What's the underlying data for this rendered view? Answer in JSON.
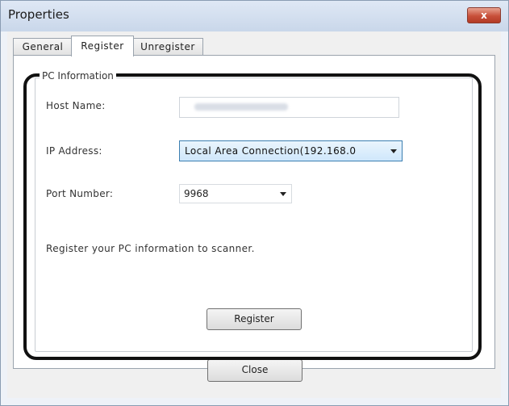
{
  "window": {
    "title": "Properties",
    "close_glyph": "x"
  },
  "tabs": [
    {
      "label": "General",
      "active": false
    },
    {
      "label": "Register",
      "active": true
    },
    {
      "label": "Unregister",
      "active": false
    }
  ],
  "group": {
    "title": "PC Information"
  },
  "fields": {
    "host_label": "Host Name:",
    "ip_label": "IP Address:",
    "ip_value": "Local Area Connection(192.168.0",
    "port_label": "Port Number:",
    "port_value": "9968"
  },
  "note": "Register your PC information to scanner.",
  "buttons": {
    "register": "Register",
    "close": "Close"
  },
  "colors": {
    "highlight_border": "#111111",
    "selected_field": "#cfe7fb"
  },
  "icons": {
    "close": "close-icon",
    "dropdown": "chevron-down-icon"
  }
}
